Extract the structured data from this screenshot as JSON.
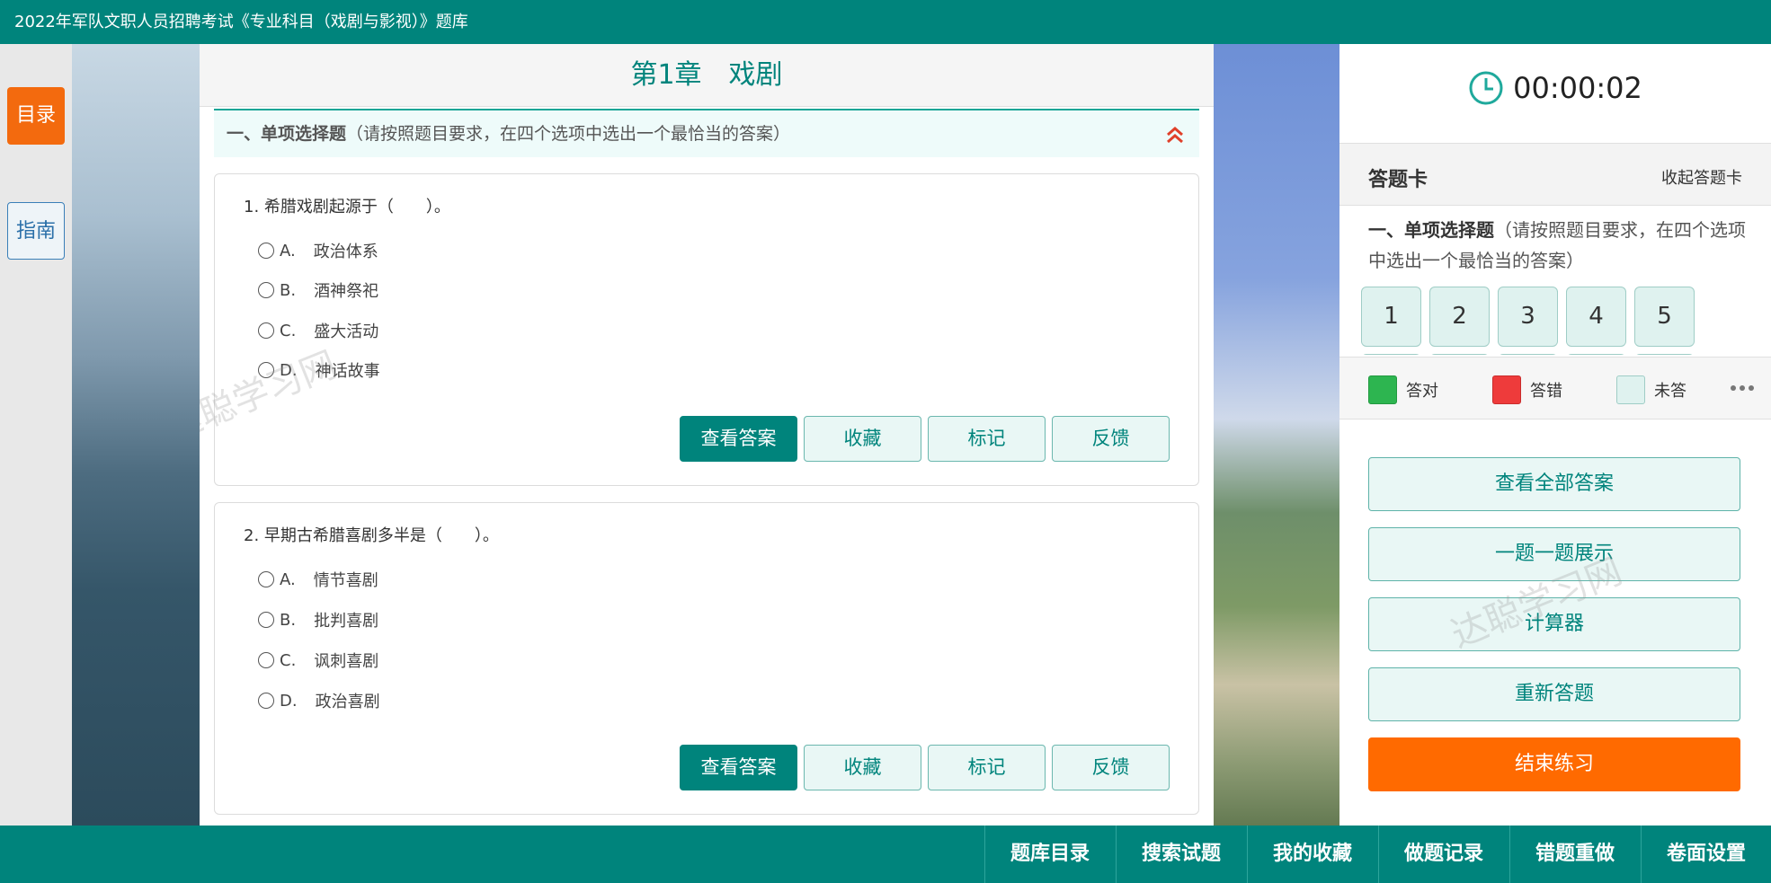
{
  "header": {
    "title": "2022年军队文职人员招聘考试《专业科目（戏剧与影视）》题库"
  },
  "side": {
    "catalog": "目录",
    "guide": "指南"
  },
  "main": {
    "chapter": "第1章　戏剧",
    "section": {
      "title": "一、单项选择题",
      "note": "（请按照题目要求，在四个选项中选出一个最恰当的答案）"
    },
    "questions": [
      {
        "stem": "1. 希腊戏剧起源于（　　）。",
        "options": [
          {
            "letter": "A.",
            "text": "政治体系"
          },
          {
            "letter": "B.",
            "text": "酒神祭祀"
          },
          {
            "letter": "C.",
            "text": "盛大活动"
          },
          {
            "letter": "D.",
            "text": "神话故事"
          }
        ]
      },
      {
        "stem": "2. 早期古希腊喜剧多半是（　　）。",
        "options": [
          {
            "letter": "A.",
            "text": "情节喜剧"
          },
          {
            "letter": "B.",
            "text": "批判喜剧"
          },
          {
            "letter": "C.",
            "text": "讽刺喜剧"
          },
          {
            "letter": "D.",
            "text": "政治喜剧"
          }
        ]
      }
    ],
    "buttons": {
      "answer": "查看答案",
      "favorite": "收藏",
      "mark": "标记",
      "feedback": "反馈"
    },
    "watermark": "达聪学习网"
  },
  "right": {
    "timer": "00:00:02",
    "card_title": "答题卡",
    "card_toggle": "收起答题卡",
    "section_title": "一、单项选择题",
    "section_note": "（请按照题目要求，在四个选项中选出一个最恰当的答案）",
    "numbers": [
      "1",
      "2",
      "3",
      "4",
      "5"
    ],
    "legend": {
      "correct": "答对",
      "wrong": "答错",
      "unanswered": "未答"
    },
    "actions": {
      "all_answers": "查看全部答案",
      "one_by_one": "一题一题展示",
      "calculator": "计算器",
      "restart": "重新答题",
      "finish": "结束练习"
    },
    "watermark": "达聪学习网"
  },
  "bottom_nav": [
    "题库目录",
    "搜索试题",
    "我的收藏",
    "做题记录",
    "错题重做",
    "卷面设置"
  ],
  "colors": {
    "brand": "#00847c",
    "orange": "#ff6a00",
    "correct": "#2db550",
    "wrong": "#ee3b3b"
  }
}
